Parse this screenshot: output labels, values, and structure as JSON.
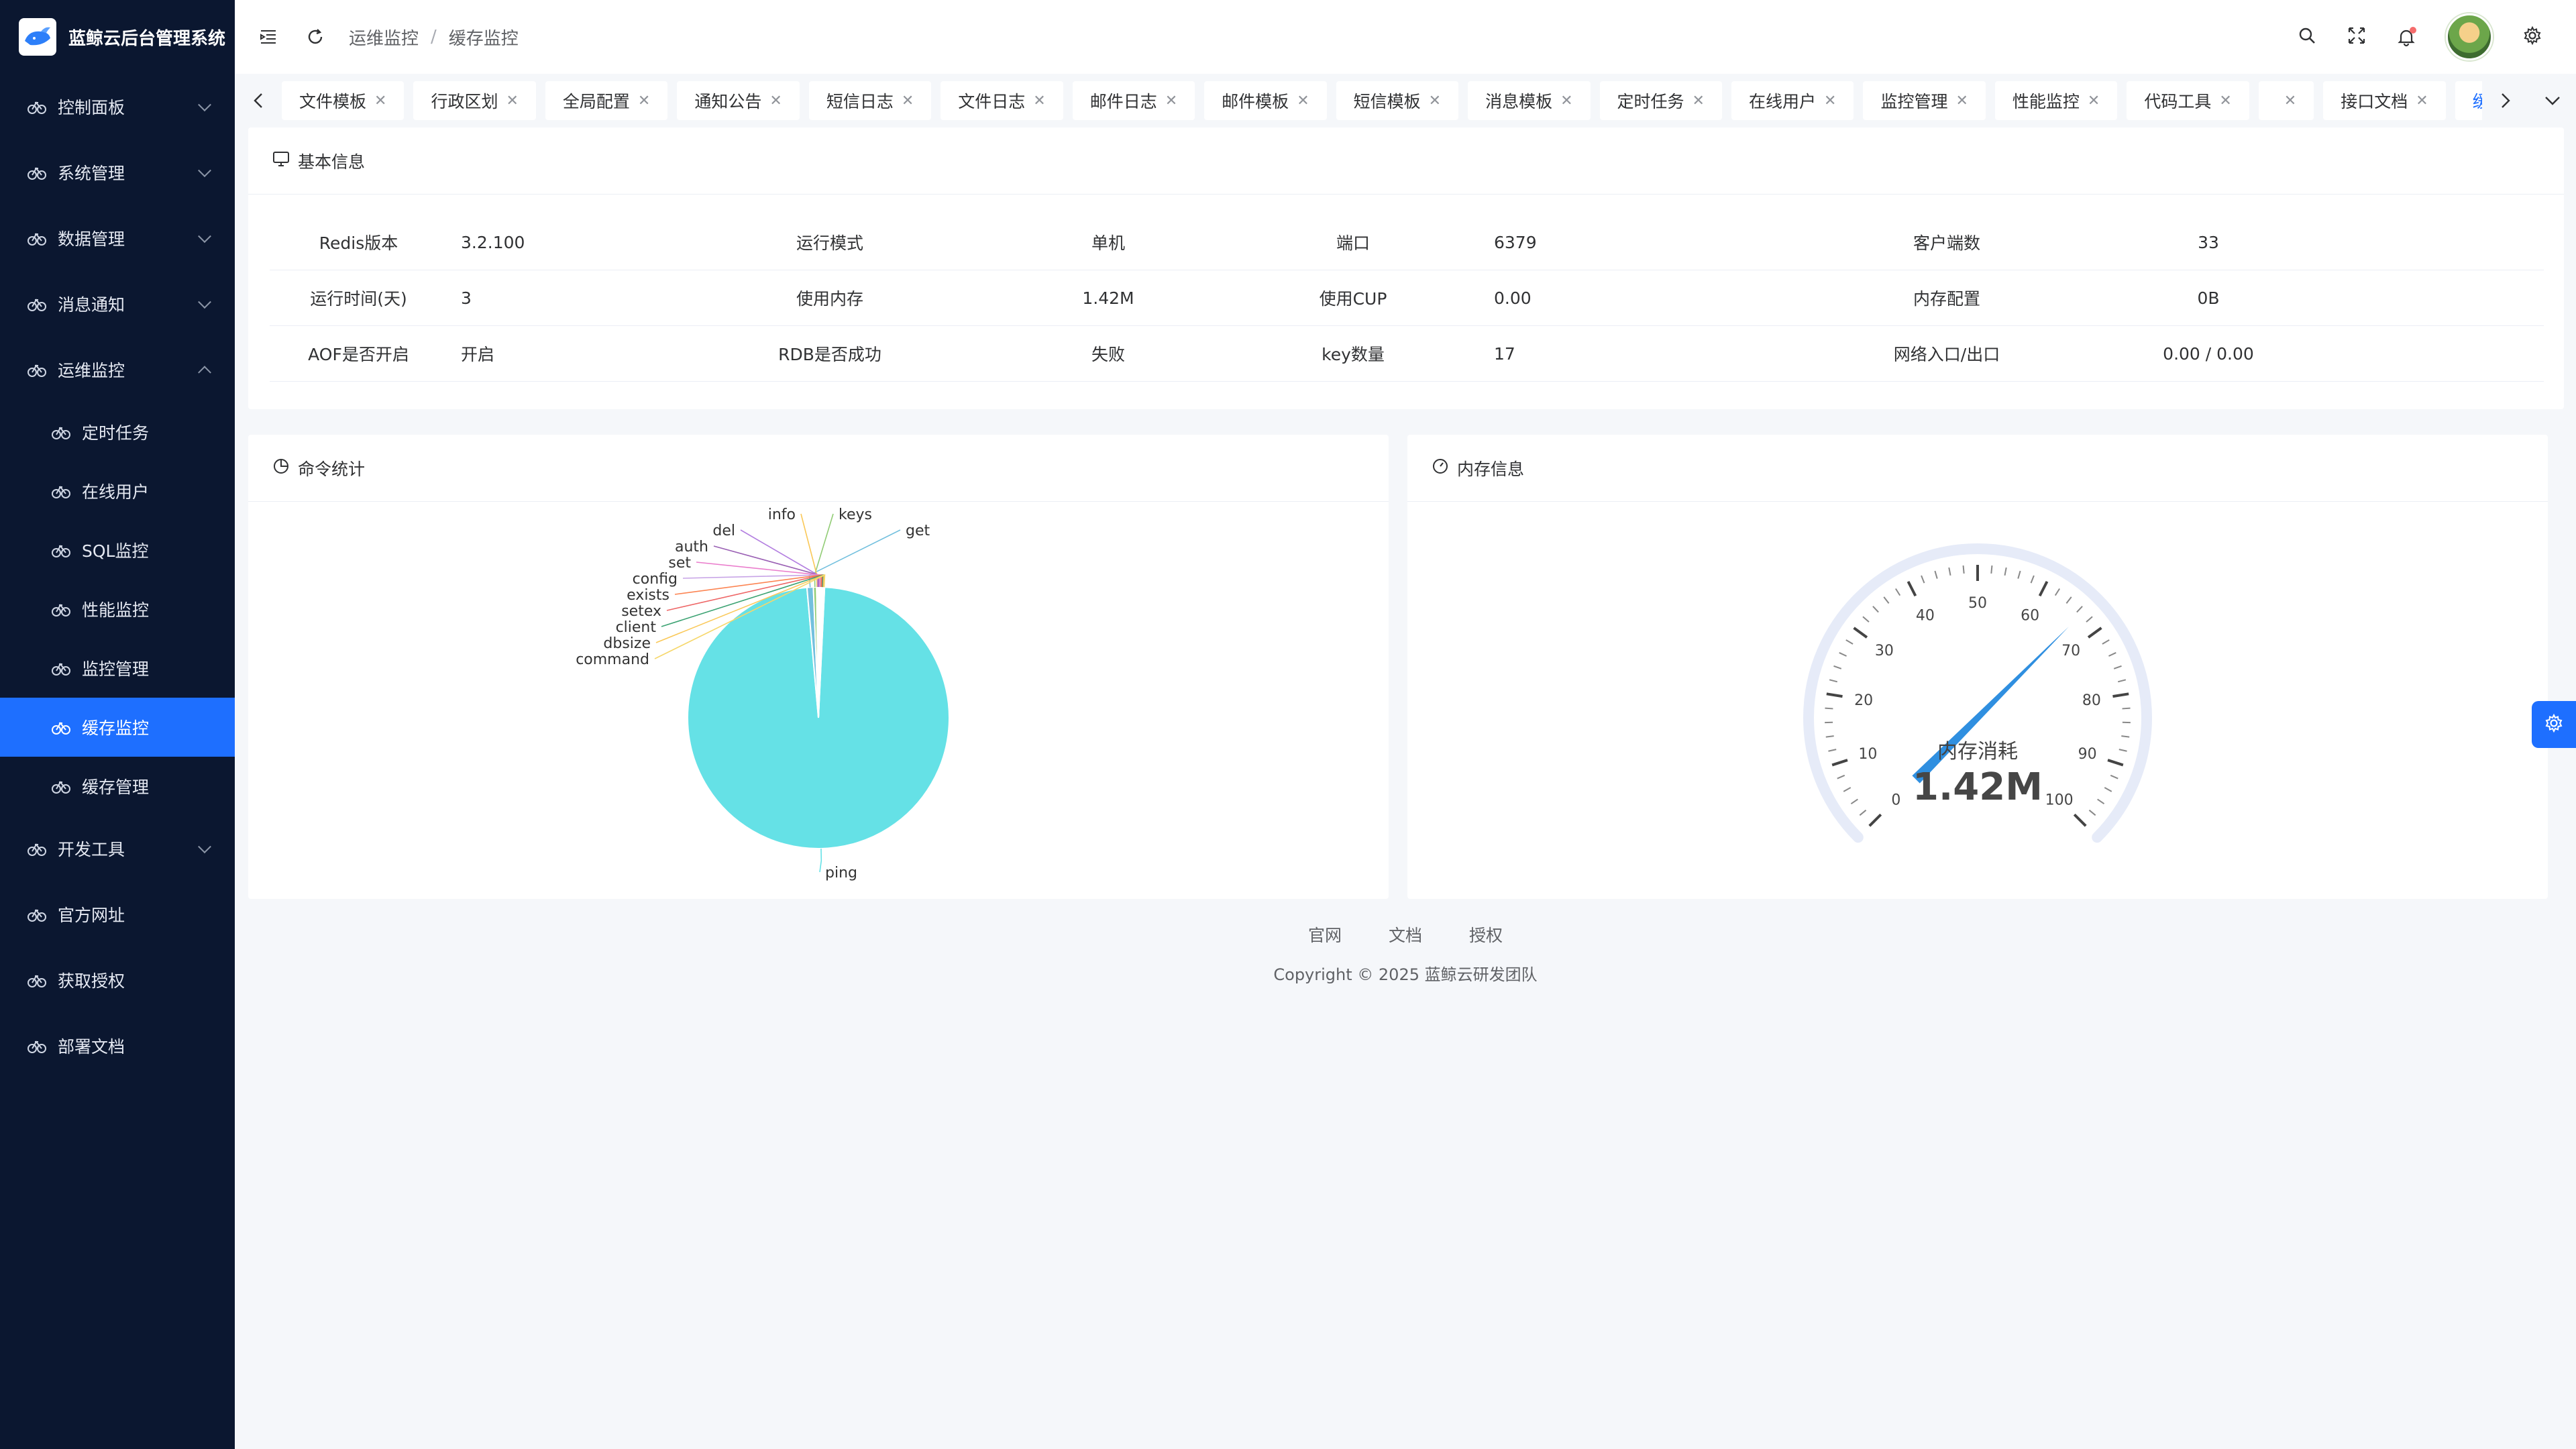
{
  "brand": {
    "title": "蓝鲸云后台管理系统"
  },
  "sidebar": {
    "items": [
      {
        "label": "控制面板"
      },
      {
        "label": "系统管理"
      },
      {
        "label": "数据管理"
      },
      {
        "label": "消息通知"
      },
      {
        "label": "运维监控"
      },
      {
        "label": "开发工具"
      },
      {
        "label": "官方网址"
      },
      {
        "label": "获取授权"
      },
      {
        "label": "部署文档"
      }
    ],
    "submenu": [
      {
        "label": "定时任务"
      },
      {
        "label": "在线用户"
      },
      {
        "label": "SQL监控"
      },
      {
        "label": "性能监控"
      },
      {
        "label": "监控管理"
      },
      {
        "label": "缓存监控"
      },
      {
        "label": "缓存管理"
      }
    ]
  },
  "header": {
    "breadcrumb": [
      "运维监控",
      "/",
      "缓存监控"
    ]
  },
  "tabs": [
    {
      "label": "文件模板"
    },
    {
      "label": "行政区划"
    },
    {
      "label": "全局配置"
    },
    {
      "label": "通知公告"
    },
    {
      "label": "短信日志"
    },
    {
      "label": "文件日志"
    },
    {
      "label": "邮件日志"
    },
    {
      "label": "邮件模板"
    },
    {
      "label": "短信模板"
    },
    {
      "label": "消息模板"
    },
    {
      "label": "定时任务"
    },
    {
      "label": "在线用户"
    },
    {
      "label": "监控管理"
    },
    {
      "label": "性能监控"
    },
    {
      "label": "代码工具"
    },
    {
      "label": ""
    },
    {
      "label": "接口文档"
    },
    {
      "label": "缓存监控"
    }
  ],
  "basic": {
    "title": "基本信息",
    "rows": [
      [
        "Redis版本",
        "3.2.100",
        "运行模式",
        "单机",
        "端口",
        "6379",
        "客户端数",
        "33"
      ],
      [
        "运行时间(天)",
        "3",
        "使用内存",
        "1.42M",
        "使用CUP",
        "0.00",
        "内存配置",
        "0B"
      ],
      [
        "AOF是否开启",
        "开启",
        "RDB是否成功",
        "失败",
        "key数量",
        "17",
        "网络入口/出口",
        "0.00 / 0.00"
      ]
    ]
  },
  "cmd": {
    "title": "命令统计",
    "chart_data": {
      "type": "pie",
      "categories": [
        "ping",
        "get",
        "keys",
        "info",
        "del",
        "auth",
        "set",
        "config",
        "exists",
        "setex",
        "client",
        "dbsize",
        "command"
      ],
      "values": [
        1000,
        8,
        4,
        1,
        1,
        1,
        1,
        1,
        1,
        1,
        1,
        1,
        1
      ],
      "colors": [
        "#65e1e6",
        "#73c0de",
        "#91cc75",
        "#fac858",
        "#b37fe0",
        "#9a60b4",
        "#ea7ccc",
        "#c7a3e6",
        "#fc8452",
        "#ee6666",
        "#3ba272",
        "#fac858",
        "#f6d76b"
      ]
    }
  },
  "mem": {
    "title": "内存信息",
    "chart_data": {
      "type": "gauge",
      "min": 0,
      "max": 100,
      "value": 1.42,
      "ticks": [
        "0",
        "10",
        "20",
        "30",
        "40",
        "50",
        "60",
        "70",
        "80",
        "90",
        "100"
      ],
      "label": "内存消耗",
      "display": "1.42M"
    }
  },
  "footer": {
    "links": [
      "官网",
      "文档",
      "授权"
    ],
    "copyright": "Copyright © 2025 蓝鲸云研发团队"
  },
  "colors": {
    "accent": "#1e6fff",
    "sidebar": "#0b1730",
    "pie": "#65e1e6"
  }
}
